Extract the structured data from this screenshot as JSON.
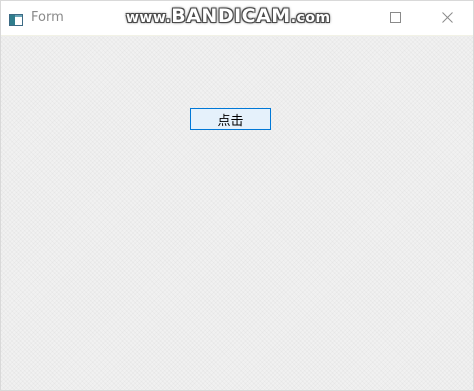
{
  "window": {
    "title": "Form",
    "icon": "form-app-icon",
    "controls": {
      "minimize_icon": "minimize-icon",
      "maximize_icon": "maximize-icon",
      "close_icon": "close-icon"
    }
  },
  "watermark": {
    "prefix": "www.",
    "brand": "BANDICAM",
    "suffix": ".com"
  },
  "form": {
    "button_label": "点击"
  },
  "colors": {
    "accent": "#0078d7",
    "button_fill": "#e5f1fb",
    "client_bg": "#f0f0f0",
    "title_text": "#8a8a8a"
  }
}
